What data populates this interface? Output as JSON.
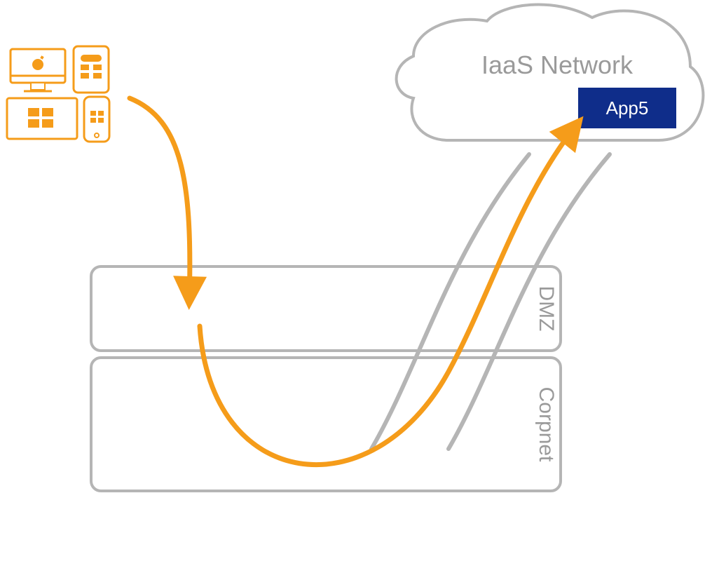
{
  "cloud": {
    "title": "IaaS Network"
  },
  "app_box": {
    "label": "App5"
  },
  "zones": {
    "dmz": {
      "label": "DMZ"
    },
    "corpnet": {
      "label": "Corpnet"
    }
  },
  "colors": {
    "orange": "#F59C1A",
    "gray": "#B5B5B5",
    "grayStroke": "#B5B5B5",
    "appBlue": "#0F2D8A",
    "textGray": "#9A9A9A"
  }
}
